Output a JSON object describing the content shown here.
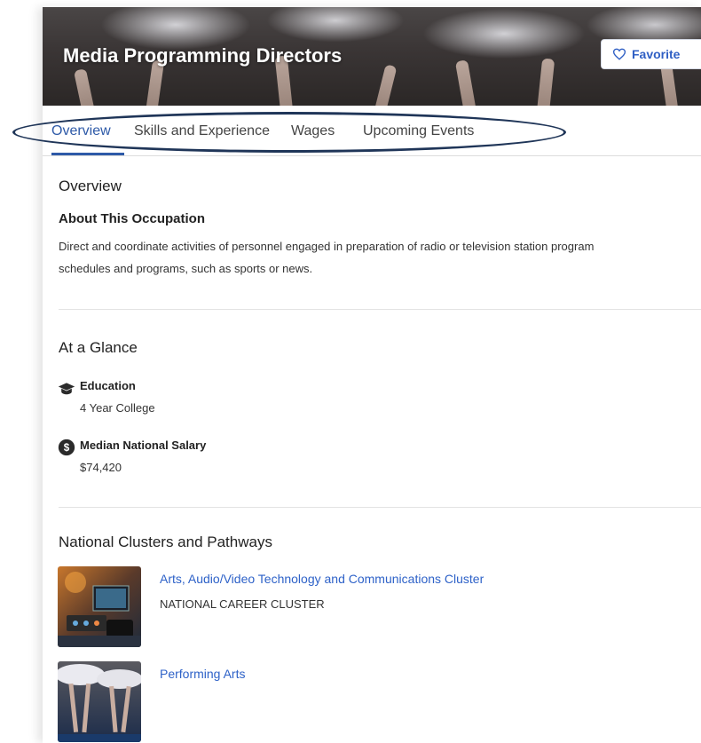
{
  "header": {
    "title": "Media Programming Directors",
    "favorite_label": "Favorite"
  },
  "tabs": [
    {
      "label": "Overview",
      "active": true
    },
    {
      "label": "Skills and Experience",
      "active": false
    },
    {
      "label": "Wages",
      "active": false
    },
    {
      "label": "Upcoming Events",
      "active": false
    }
  ],
  "overview": {
    "heading": "Overview",
    "about_heading": "About This Occupation",
    "about_text_line1": "Direct and coordinate activities of personnel engaged in preparation of radio or television station program",
    "about_text_line2": "schedules and programs, such as sports or news."
  },
  "glance": {
    "heading": "At a Glance",
    "items": [
      {
        "label": "Education",
        "value": "4 Year College",
        "icon": "graduation-cap-icon"
      },
      {
        "label": "Median National Salary",
        "value": "$74,420",
        "icon": "dollar-circle-icon"
      }
    ]
  },
  "clusters": {
    "heading": "National Clusters and Pathways",
    "items": [
      {
        "title": "Arts, Audio/Video Technology and Communications Cluster",
        "subtitle": "NATIONAL CAREER CLUSTER"
      },
      {
        "title": "Performing Arts",
        "subtitle": ""
      }
    ]
  },
  "colors": {
    "accent": "#2e5aa8",
    "link": "#2e62c8",
    "annotation": "#1f3558"
  }
}
